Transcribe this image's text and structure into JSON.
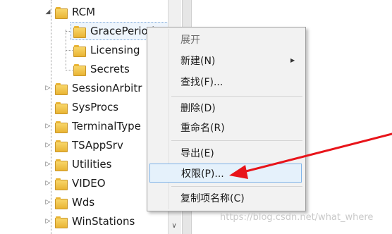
{
  "tree": {
    "nodes": [
      {
        "label": "RCM",
        "expander": "expanded"
      },
      {
        "label": "GracePeriod",
        "expander": "none",
        "selected": true
      },
      {
        "label": "Licensing",
        "expander": "none"
      },
      {
        "label": "Secrets",
        "expander": "none"
      },
      {
        "label": "SessionArbitr",
        "expander": "collapsed"
      },
      {
        "label": "SysProcs",
        "expander": "none"
      },
      {
        "label": "TerminalType",
        "expander": "collapsed"
      },
      {
        "label": "TSAppSrv",
        "expander": "collapsed"
      },
      {
        "label": "Utilities",
        "expander": "collapsed"
      },
      {
        "label": "VIDEO",
        "expander": "collapsed"
      },
      {
        "label": "Wds",
        "expander": "collapsed"
      },
      {
        "label": "WinStations",
        "expander": "collapsed"
      }
    ]
  },
  "context_menu": {
    "items": [
      {
        "label": "展开",
        "disabled": true
      },
      {
        "label": "新建(N)",
        "submenu": true
      },
      {
        "label": "查找(F)..."
      },
      {
        "label": "删除(D)"
      },
      {
        "label": "重命名(R)"
      },
      {
        "label": "导出(E)"
      },
      {
        "label": "权限(P)...",
        "highlighted": true
      },
      {
        "label": "复制项名称(C)"
      }
    ]
  },
  "annotation": {
    "arrow_color": "#e8141a"
  },
  "watermark": "https://blog.csdn.net/what_where"
}
